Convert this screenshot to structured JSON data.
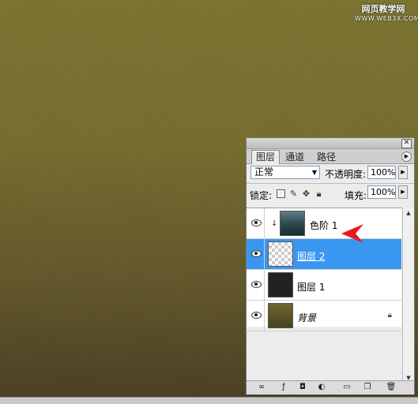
{
  "watermark": {
    "line1": "网页教学网",
    "line2": "WWW.WEB3X.COM"
  },
  "panel": {
    "tabs": [
      {
        "label": "图层",
        "active": true
      },
      {
        "label": "通道",
        "active": false
      },
      {
        "label": "路径",
        "active": false
      }
    ],
    "blend_mode": "正常",
    "opacity_label": "不透明度:",
    "opacity_value": "100%",
    "lock_label": "锁定:",
    "fill_label": "填充:",
    "fill_value": "100%",
    "layers": [
      {
        "name": "色阶 1",
        "clipped": true,
        "selected": false
      },
      {
        "name": "图层 2",
        "clipped": false,
        "selected": true
      },
      {
        "name": "图层 1",
        "clipped": false,
        "selected": false
      },
      {
        "name": "背景",
        "clipped": false,
        "selected": false,
        "locked": true
      }
    ],
    "bottom_icons": [
      "link-icon",
      "layer-style-icon",
      "mask-icon",
      "adjustment-icon",
      "folder-icon",
      "new-layer-icon",
      "trash-icon"
    ]
  },
  "colors": {
    "selection": "#3a97f0",
    "canvas": "#766d2e",
    "arrow": "#e8191d"
  }
}
